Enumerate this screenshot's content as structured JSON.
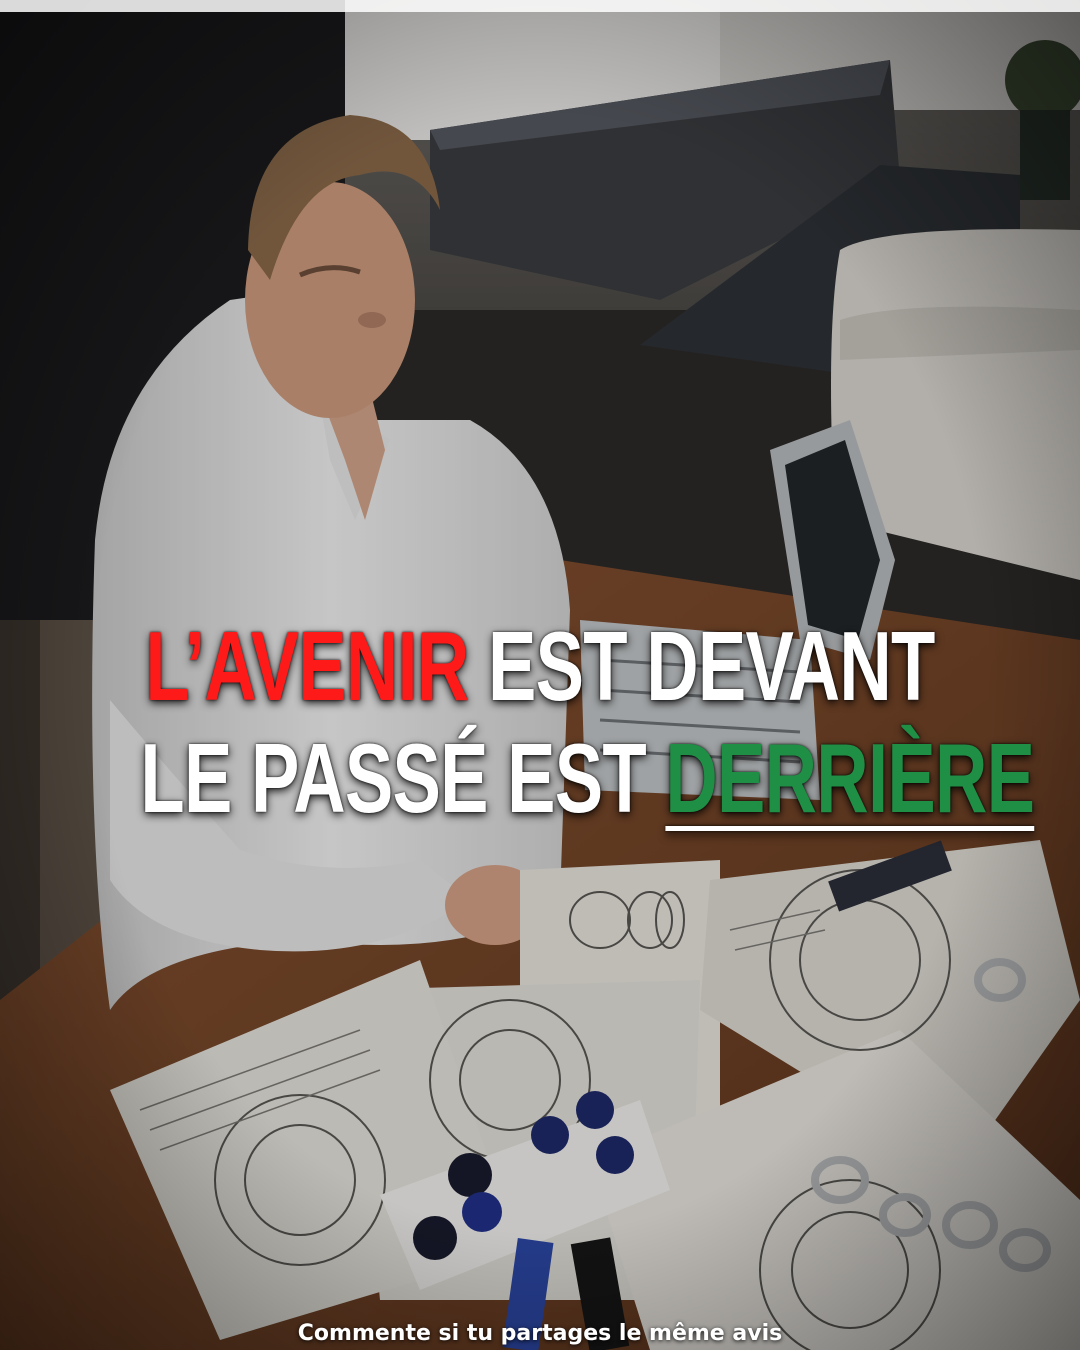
{
  "headline": {
    "line1": {
      "highlight": "L’AVENIR",
      "rest": "EST DEVANT"
    },
    "line2": {
      "rest": "LE PASSÉ EST",
      "highlight": "DERRIÈRE"
    },
    "colors": {
      "red": "#ff1a1a",
      "white": "#ffffff",
      "green": "#1f8f46"
    }
  },
  "footer": {
    "text": "Commente si tu partages le même avis"
  }
}
